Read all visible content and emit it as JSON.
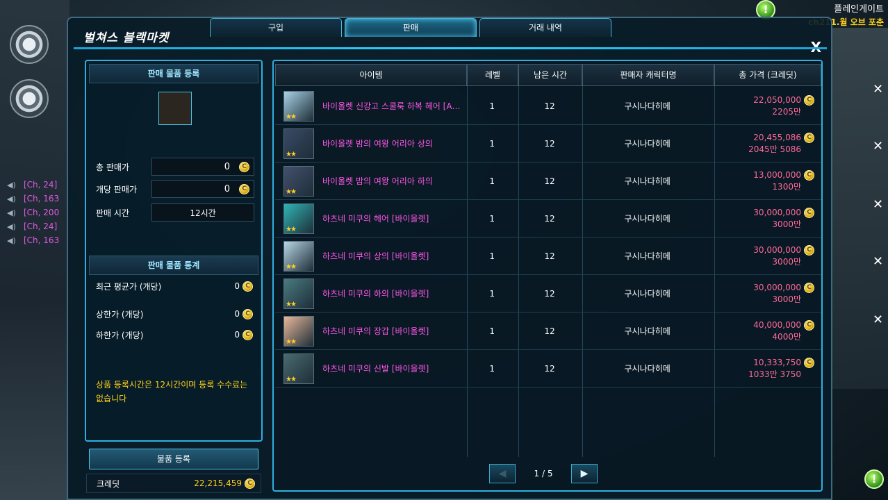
{
  "hud": {
    "server_name": "플레인게이트",
    "channel": "ch211.월 오브 포춘",
    "chat_lines": [
      "[Ch, 24]",
      "[Ch, 163",
      "[Ch, 200",
      "[Ch, 24]",
      "[Ch, 163"
    ]
  },
  "window": {
    "title": "벌쳐스 블랙마켓",
    "tabs": [
      {
        "label": "구입",
        "active": false
      },
      {
        "label": "판매",
        "active": true
      },
      {
        "label": "거래 내역",
        "active": false
      }
    ],
    "close": "X"
  },
  "left": {
    "register_header": "판매 물품 등록",
    "total_price_label": "총 판매가",
    "total_price_value": "0",
    "unit_price_label": "개당 판매가",
    "unit_price_value": "0",
    "sell_time_label": "판매 시간",
    "sell_time_value": "12시간",
    "stats_header": "판매 물품 통계",
    "stats": [
      {
        "label": "최근 평균가 (개당)",
        "value": "0"
      },
      {
        "label": "상한가 (개당)",
        "value": "0"
      },
      {
        "label": "하한가 (개당)",
        "value": "0"
      }
    ],
    "notice": "상품 등록시간은 12시간이며 등록 수수료는 없습니다",
    "register_button": "물품 등록",
    "credit_label": "크레딧",
    "credit_value": "22,215,459"
  },
  "table": {
    "headers": [
      "아이템",
      "레벨",
      "남은 시간",
      "판매자 캐릭터명",
      "총 가격 (크레딧)"
    ],
    "rows": [
      {
        "name": "바이올렛 신강고 스쿨룩 하복 헤어 [A타...",
        "level": "1",
        "time": "12",
        "seller": "구시나다히메",
        "price": "22,050,000",
        "unit": "2205만"
      },
      {
        "name": "바이올렛 밤의 여왕 어리아 상의",
        "level": "1",
        "time": "12",
        "seller": "구시나다히메",
        "price": "20,455,086",
        "unit": "2045만 5086"
      },
      {
        "name": "바이올렛 밤의 여왕 어리아 하의",
        "level": "1",
        "time": "12",
        "seller": "구시나다히메",
        "price": "13,000,000",
        "unit": "1300만"
      },
      {
        "name": "하츠네 미쿠의 헤어 [바이올렛]",
        "level": "1",
        "time": "12",
        "seller": "구시나다히메",
        "price": "30,000,000",
        "unit": "3000만"
      },
      {
        "name": "하츠네 미쿠의 상의 [바이올렛]",
        "level": "1",
        "time": "12",
        "seller": "구시나다히메",
        "price": "30,000,000",
        "unit": "3000만"
      },
      {
        "name": "하츠네 미쿠의 하의 [바이올렛]",
        "level": "1",
        "time": "12",
        "seller": "구시나다히메",
        "price": "30,000,000",
        "unit": "3000만"
      },
      {
        "name": "하츠네 미쿠의 장갑 [바이올렛]",
        "level": "1",
        "time": "12",
        "seller": "구시나다히메",
        "price": "40,000,000",
        "unit": "4000만"
      },
      {
        "name": "하츠네 미쿠의 신발 [바이올렛]",
        "level": "1",
        "time": "12",
        "seller": "구시나다히메",
        "price": "10,333,750",
        "unit": "1033만 3750"
      }
    ],
    "page": "1 / 5",
    "prev": "◀",
    "next": "▶"
  },
  "colors": {
    "accent": "#2fb0e0",
    "item_name": "#ff55e6",
    "price": "#ff6a98",
    "gold": "#ffd21a"
  }
}
